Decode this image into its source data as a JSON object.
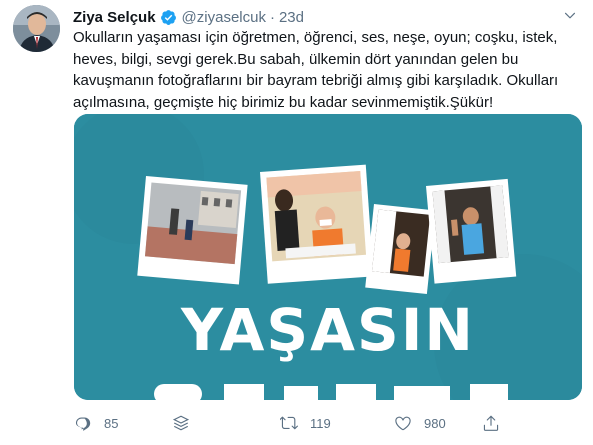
{
  "tweet": {
    "author_name": "Ziya Selçuk",
    "handle": "@ziyaselcuk",
    "separator": "·",
    "time": "23d",
    "text": "Okulların yaşaması için öğretmen, öğrenci, ses, neşe, oyun; coşku, istek, heves, bilgi, sevgi gerek.Bu sabah, ülkemin dört yanından gelen bu kavuşmanın fotoğraflarını bir bayram tebriği almış gibi karşıladık. Okulları açılmasına, geçmişte hiç birimiz bu kadar sevinmemiştik.Şükür!",
    "image_headline": "YAŞASIN",
    "replies": "85",
    "retweets": "119",
    "likes": "980"
  },
  "colors": {
    "media_bg": "#2c8da0",
    "verified": "#1da1f2",
    "muted": "#5b7083"
  },
  "icons": [
    "verified-badge-icon",
    "chevron-down-icon",
    "reply-icon",
    "layers-icon",
    "retweet-icon",
    "like-icon",
    "share-icon"
  ]
}
